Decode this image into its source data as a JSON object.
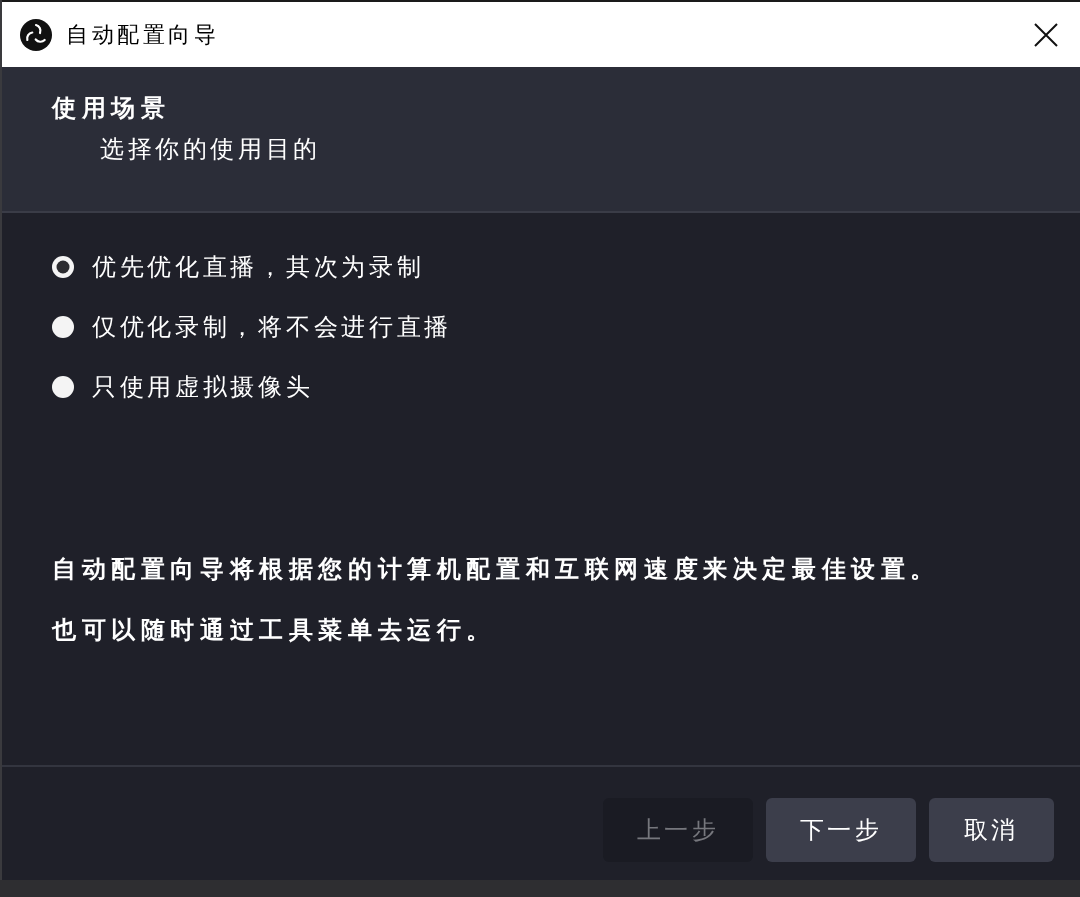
{
  "window": {
    "title": "自动配置向导"
  },
  "header": {
    "title": "使用场景",
    "subtitle": "选择你的使用目的"
  },
  "options": [
    {
      "label": "优先优化直播，其次为录制",
      "selected": true
    },
    {
      "label": "仅优化录制，将不会进行直播",
      "selected": false
    },
    {
      "label": "只使用虚拟摄像头",
      "selected": false
    }
  ],
  "info": [
    "自动配置向导将根据您的计算机配置和互联网速度来决定最佳设置。",
    "也可以随时通过工具菜单去运行。"
  ],
  "buttons": [
    {
      "label": "上一步",
      "disabled": true
    },
    {
      "label": "下一步",
      "disabled": false
    },
    {
      "label": "取消",
      "disabled": false
    }
  ]
}
